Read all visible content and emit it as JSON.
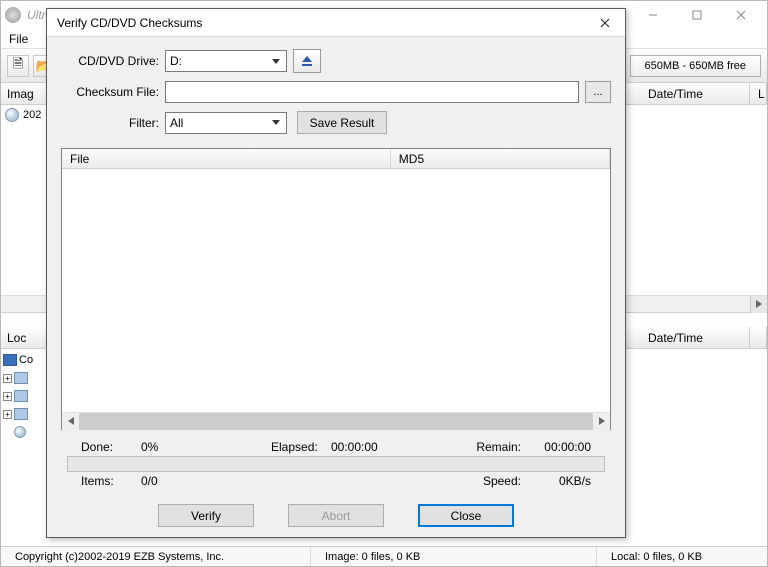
{
  "parent": {
    "title": "UltraISO (Trial Version)",
    "menu_file": "File",
    "upper_tab": "Imag",
    "tree_label": "202",
    "lower_tab": "Loc",
    "lower_tree_root": "Co",
    "size_label": "650MB - 650MB free",
    "cols": {
      "datetime": "Date/Time"
    },
    "status": {
      "copyright": "Copyright (c)2002-2019 EZB Systems, Inc.",
      "image": "Image: 0 files, 0 KB",
      "local": "Local: 0 files, 0 KB"
    }
  },
  "dialog": {
    "title": "Verify CD/DVD Checksums",
    "labels": {
      "drive": "CD/DVD Drive:",
      "checksum_file": "Checksum File:",
      "filter": "Filter:"
    },
    "drive_value": "D:",
    "checksum_file_value": "",
    "browse_label": "...",
    "filter_value": "All",
    "save_result": "Save Result",
    "list_cols": {
      "file": "File",
      "md5": "MD5"
    },
    "stats": {
      "done_label": "Done:",
      "done_value": "0%",
      "elapsed_label": "Elapsed:",
      "elapsed_value": "00:00:00",
      "remain_label": "Remain:",
      "remain_value": "00:00:00",
      "items_label": "Items:",
      "items_value": "0/0",
      "speed_label": "Speed:",
      "speed_value": "0KB/s"
    },
    "buttons": {
      "verify": "Verify",
      "abort": "Abort",
      "close": "Close"
    }
  }
}
